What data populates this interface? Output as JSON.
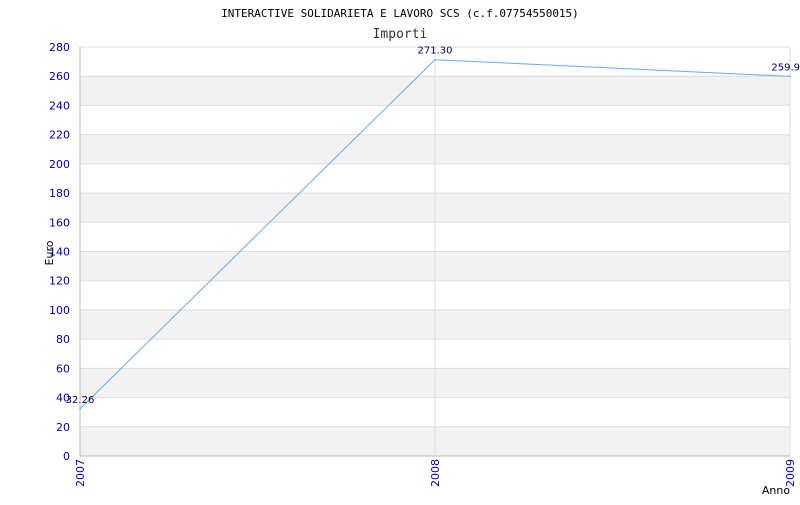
{
  "chart_data": {
    "type": "line",
    "title": "INTERACTIVE SOLIDARIETA E LAVORO SCS (c.f.07754550015)",
    "subtitle": "Importi",
    "xlabel": "Anno",
    "ylabel": "Euro",
    "x": [
      "2007",
      "2008",
      "2009"
    ],
    "series": [
      {
        "values": [
          32.26,
          271.3,
          259.9
        ]
      }
    ],
    "data_labels": [
      "32.26",
      "271.30",
      "259.9"
    ],
    "ylim": [
      0,
      280
    ],
    "yticks": [
      "0",
      "20",
      "40",
      "60",
      "80",
      "100",
      "120",
      "140",
      "160",
      "180",
      "200",
      "220",
      "240",
      "260",
      "280"
    ],
    "grid": true,
    "colors": {
      "line": "#66aaee",
      "band": "#f2f2f2",
      "grid": "#dddddd",
      "tick_text": "#0000aa",
      "data_label": "#000066"
    }
  }
}
